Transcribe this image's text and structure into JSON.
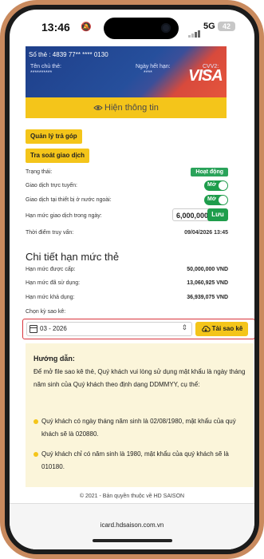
{
  "status_bar": {
    "time": "13:46",
    "network": "5G",
    "battery": "42"
  },
  "card": {
    "number_label": "Số thẻ : 4839 77** **** 0130",
    "holder_label": "Tên chủ thẻ:",
    "holder_value": "**********",
    "expiry_label": "Ngày hết hạn:",
    "expiry_value": "****",
    "cvv_label": "CVV2:",
    "cvv_value": "***",
    "brand": "VISA"
  },
  "show_info_label": "Hiện thông tin",
  "buttons": {
    "installment": "Quản lý trả góp",
    "transaction_review": "Tra soát giao dịch"
  },
  "settings": {
    "status_label": "Trạng thái:",
    "status_value": "Hoạt động",
    "online_label": "Giao dịch trực tuyến:",
    "online_value": "Mở",
    "overseas_label": "Giao dịch tại thiết bị ở nước ngoài:",
    "overseas_value": "Mở",
    "daily_limit_label": "Hạn mức giao dịch trong ngày:",
    "daily_limit_value": "6,000,000",
    "save_label": "Lưu",
    "access_label": "Thời điểm truy vấn:",
    "access_value": "09/04/2026 13:45"
  },
  "limit_detail": {
    "title": "Chi tiết hạn mức thẻ",
    "granted_label": "Hạn mức được cấp:",
    "granted_value": "50,000,000 VND",
    "used_label": "Hạn mức đã sử dụng:",
    "used_value": "13,060,925 VND",
    "available_label": "Hạn mức khả dụng:",
    "available_value": "36,939,075 VND"
  },
  "statement": {
    "period_label": "Chọn kỳ sao kê:",
    "period_value": "03 - 2026",
    "download_label": "Tải sao kê"
  },
  "guide": {
    "title": "Hướng dẫn:",
    "intro": "Để mở file sao kê thẻ, Quý khách vui lòng sử dụng mật khẩu là ngày tháng năm sinh của Quý khách theo định dạng DDMMYY, cụ thể:",
    "example1": "Quý khách có ngày tháng năm sinh là 02/08/1980, mật khẩu của quý khách sẽ là 020880.",
    "example2": "Quý khách chỉ có năm sinh là 1980, mật khẩu của quý khách sẽ là 010180."
  },
  "footer": "© 2021 - Bản quyền thuộc về HD SAISON",
  "url": "icard.hdsaison.com.vn",
  "colors": {
    "accent": "#f4c51a",
    "green": "#1f9d4c",
    "highlight_border": "#d9343c"
  }
}
